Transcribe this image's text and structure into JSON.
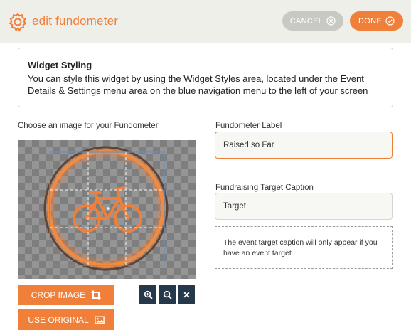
{
  "header": {
    "title": "edit fundometer",
    "cancel_label": "CANCEL",
    "done_label": "DONE",
    "brand_color": "#f07f3a"
  },
  "info": {
    "title": "Widget Styling",
    "text": "You can style this widget by using the Widget Styles area, located under the Event Details & Settings menu area on the blue navigation menu to the left of your screen"
  },
  "image_section": {
    "label": "Choose an image for your Fundometer",
    "crop_label": "CROP IMAGE",
    "use_original_label": "USE ORIGINAL",
    "icons": [
      "bicycle-image",
      "zoom-in-icon",
      "zoom-out-icon",
      "close-icon"
    ]
  },
  "fundometer_label": {
    "label": "Fundometer Label",
    "value": "Raised so Far"
  },
  "target_caption": {
    "label": "Fundraising Target Caption",
    "value": "Target",
    "note": "The event target caption will only appear if you have an event target."
  }
}
